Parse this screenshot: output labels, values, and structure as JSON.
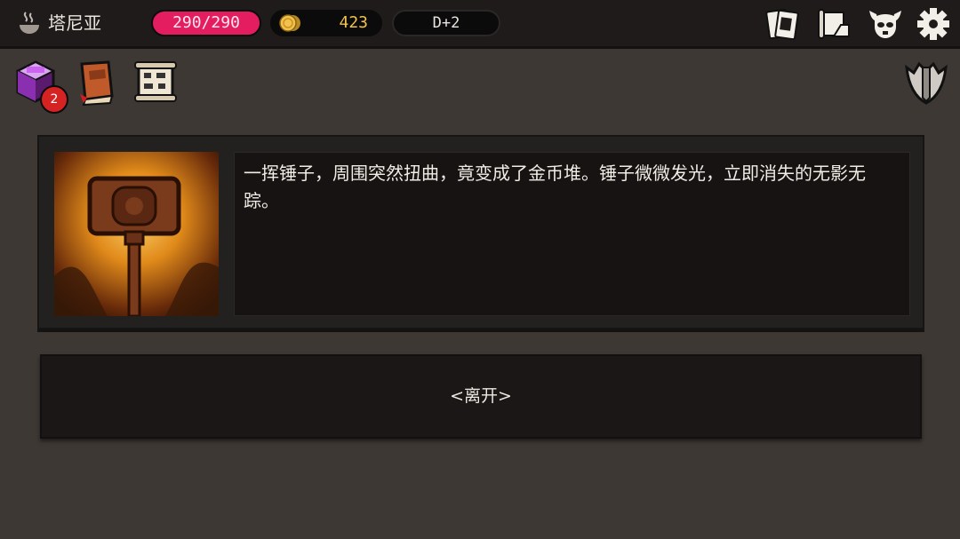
{
  "header": {
    "character_icon": "steam-bowl-icon",
    "character_name": "塔尼亚",
    "hp": "290/290",
    "gold": "423",
    "day": "D+2"
  },
  "header_icons": [
    "cards-icon",
    "map-scroll-icon",
    "demon-skull-icon",
    "gear-icon"
  ],
  "toolbar": {
    "items": [
      {
        "icon": "potion-cube-icon",
        "badge": "2"
      },
      {
        "icon": "spellbook-icon"
      },
      {
        "icon": "quest-scroll-icon"
      }
    ],
    "right_icon": "crest-shield-icon"
  },
  "event": {
    "image": "golden-hammer-illustration",
    "text": "一挥锤子，周围突然扭曲，竟变成了金币堆。锤子微微发光，立即消失的无影无踪。"
  },
  "choices": [
    {
      "label": "<离开>"
    }
  ],
  "colors": {
    "hp": "#e41d60",
    "gold": "#f2c14e",
    "background": "#3e3834",
    "panel": "#232020"
  }
}
